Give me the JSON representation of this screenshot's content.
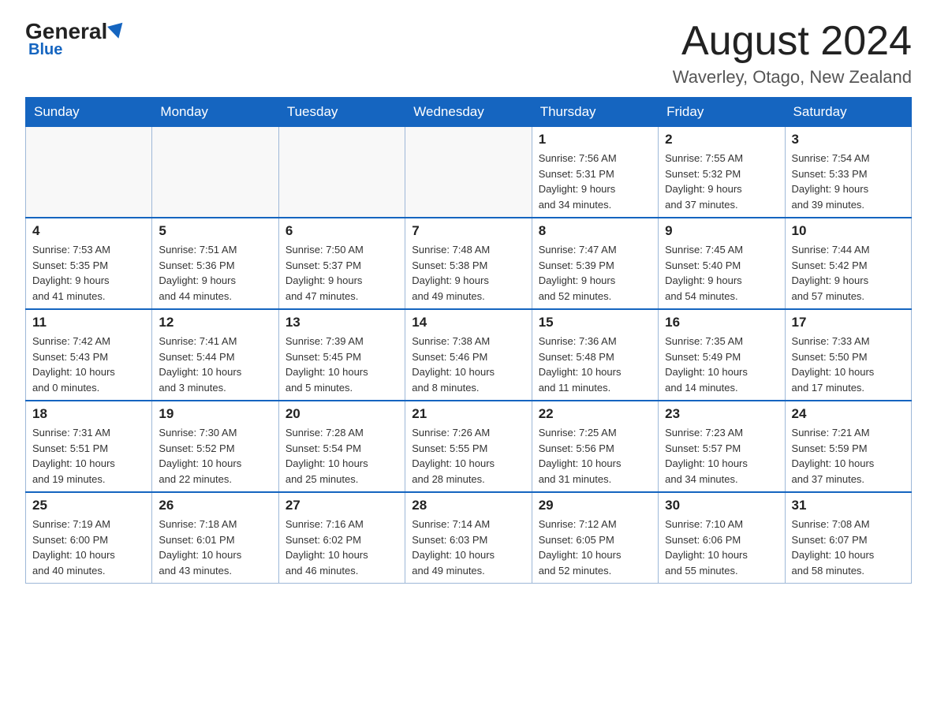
{
  "header": {
    "logo_general": "General",
    "logo_blue": "Blue",
    "month_title": "August 2024",
    "location": "Waverley, Otago, New Zealand"
  },
  "weekdays": [
    "Sunday",
    "Monday",
    "Tuesday",
    "Wednesday",
    "Thursday",
    "Friday",
    "Saturday"
  ],
  "weeks": [
    [
      {
        "day": "",
        "info": ""
      },
      {
        "day": "",
        "info": ""
      },
      {
        "day": "",
        "info": ""
      },
      {
        "day": "",
        "info": ""
      },
      {
        "day": "1",
        "info": "Sunrise: 7:56 AM\nSunset: 5:31 PM\nDaylight: 9 hours\nand 34 minutes."
      },
      {
        "day": "2",
        "info": "Sunrise: 7:55 AM\nSunset: 5:32 PM\nDaylight: 9 hours\nand 37 minutes."
      },
      {
        "day": "3",
        "info": "Sunrise: 7:54 AM\nSunset: 5:33 PM\nDaylight: 9 hours\nand 39 minutes."
      }
    ],
    [
      {
        "day": "4",
        "info": "Sunrise: 7:53 AM\nSunset: 5:35 PM\nDaylight: 9 hours\nand 41 minutes."
      },
      {
        "day": "5",
        "info": "Sunrise: 7:51 AM\nSunset: 5:36 PM\nDaylight: 9 hours\nand 44 minutes."
      },
      {
        "day": "6",
        "info": "Sunrise: 7:50 AM\nSunset: 5:37 PM\nDaylight: 9 hours\nand 47 minutes."
      },
      {
        "day": "7",
        "info": "Sunrise: 7:48 AM\nSunset: 5:38 PM\nDaylight: 9 hours\nand 49 minutes."
      },
      {
        "day": "8",
        "info": "Sunrise: 7:47 AM\nSunset: 5:39 PM\nDaylight: 9 hours\nand 52 minutes."
      },
      {
        "day": "9",
        "info": "Sunrise: 7:45 AM\nSunset: 5:40 PM\nDaylight: 9 hours\nand 54 minutes."
      },
      {
        "day": "10",
        "info": "Sunrise: 7:44 AM\nSunset: 5:42 PM\nDaylight: 9 hours\nand 57 minutes."
      }
    ],
    [
      {
        "day": "11",
        "info": "Sunrise: 7:42 AM\nSunset: 5:43 PM\nDaylight: 10 hours\nand 0 minutes."
      },
      {
        "day": "12",
        "info": "Sunrise: 7:41 AM\nSunset: 5:44 PM\nDaylight: 10 hours\nand 3 minutes."
      },
      {
        "day": "13",
        "info": "Sunrise: 7:39 AM\nSunset: 5:45 PM\nDaylight: 10 hours\nand 5 minutes."
      },
      {
        "day": "14",
        "info": "Sunrise: 7:38 AM\nSunset: 5:46 PM\nDaylight: 10 hours\nand 8 minutes."
      },
      {
        "day": "15",
        "info": "Sunrise: 7:36 AM\nSunset: 5:48 PM\nDaylight: 10 hours\nand 11 minutes."
      },
      {
        "day": "16",
        "info": "Sunrise: 7:35 AM\nSunset: 5:49 PM\nDaylight: 10 hours\nand 14 minutes."
      },
      {
        "day": "17",
        "info": "Sunrise: 7:33 AM\nSunset: 5:50 PM\nDaylight: 10 hours\nand 17 minutes."
      }
    ],
    [
      {
        "day": "18",
        "info": "Sunrise: 7:31 AM\nSunset: 5:51 PM\nDaylight: 10 hours\nand 19 minutes."
      },
      {
        "day": "19",
        "info": "Sunrise: 7:30 AM\nSunset: 5:52 PM\nDaylight: 10 hours\nand 22 minutes."
      },
      {
        "day": "20",
        "info": "Sunrise: 7:28 AM\nSunset: 5:54 PM\nDaylight: 10 hours\nand 25 minutes."
      },
      {
        "day": "21",
        "info": "Sunrise: 7:26 AM\nSunset: 5:55 PM\nDaylight: 10 hours\nand 28 minutes."
      },
      {
        "day": "22",
        "info": "Sunrise: 7:25 AM\nSunset: 5:56 PM\nDaylight: 10 hours\nand 31 minutes."
      },
      {
        "day": "23",
        "info": "Sunrise: 7:23 AM\nSunset: 5:57 PM\nDaylight: 10 hours\nand 34 minutes."
      },
      {
        "day": "24",
        "info": "Sunrise: 7:21 AM\nSunset: 5:59 PM\nDaylight: 10 hours\nand 37 minutes."
      }
    ],
    [
      {
        "day": "25",
        "info": "Sunrise: 7:19 AM\nSunset: 6:00 PM\nDaylight: 10 hours\nand 40 minutes."
      },
      {
        "day": "26",
        "info": "Sunrise: 7:18 AM\nSunset: 6:01 PM\nDaylight: 10 hours\nand 43 minutes."
      },
      {
        "day": "27",
        "info": "Sunrise: 7:16 AM\nSunset: 6:02 PM\nDaylight: 10 hours\nand 46 minutes."
      },
      {
        "day": "28",
        "info": "Sunrise: 7:14 AM\nSunset: 6:03 PM\nDaylight: 10 hours\nand 49 minutes."
      },
      {
        "day": "29",
        "info": "Sunrise: 7:12 AM\nSunset: 6:05 PM\nDaylight: 10 hours\nand 52 minutes."
      },
      {
        "day": "30",
        "info": "Sunrise: 7:10 AM\nSunset: 6:06 PM\nDaylight: 10 hours\nand 55 minutes."
      },
      {
        "day": "31",
        "info": "Sunrise: 7:08 AM\nSunset: 6:07 PM\nDaylight: 10 hours\nand 58 minutes."
      }
    ]
  ]
}
